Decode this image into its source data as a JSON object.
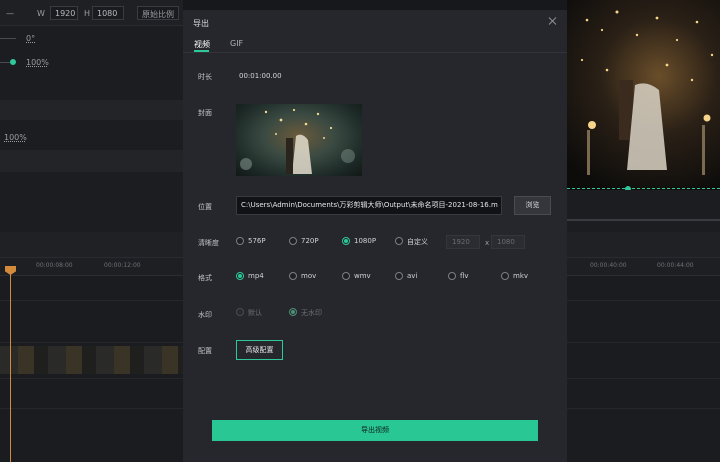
{
  "background": {
    "width_label": "W",
    "width_value": "1920",
    "height_label": "H",
    "height_value": "1080",
    "ratio_button": "原始比例",
    "rotation_value": "0°",
    "opacity_value": "100%",
    "scale_value": "100%",
    "ruler_ticks": [
      "00:00:08:00",
      "00:00:12:00",
      "00:00:40:00",
      "00:00:44:00"
    ]
  },
  "dialog": {
    "title": "导出",
    "tabs": [
      {
        "label": "视频",
        "active": true
      },
      {
        "label": "GIF",
        "active": false
      }
    ],
    "duration": {
      "label": "时长",
      "value": "00:01:00.00"
    },
    "cover": {
      "label": "封面"
    },
    "location": {
      "label": "位置",
      "path": "C:\\Users\\Admin\\Documents\\万彩剪辑大师\\Output\\未命名项目-2021-08-16.m",
      "browse": "浏览"
    },
    "resolution": {
      "label": "清晰度",
      "options": [
        "576P",
        "720P",
        "1080P",
        "自定义"
      ],
      "selected": "1080P",
      "custom_width": "1920",
      "custom_x": "x",
      "custom_height": "1080"
    },
    "format": {
      "label": "格式",
      "options": [
        "mp4",
        "mov",
        "wmv",
        "avi",
        "flv",
        "mkv"
      ],
      "selected": "mp4"
    },
    "watermark": {
      "label": "水印",
      "options": [
        "默认",
        "无水印"
      ],
      "selected": "无水印"
    },
    "config": {
      "label": "配置",
      "button": "高级配置"
    },
    "export_button": "导出视频"
  },
  "colors": {
    "accent": "#2fc89b",
    "dialog_bg": "#26272d",
    "playhead": "#d38a3a"
  }
}
